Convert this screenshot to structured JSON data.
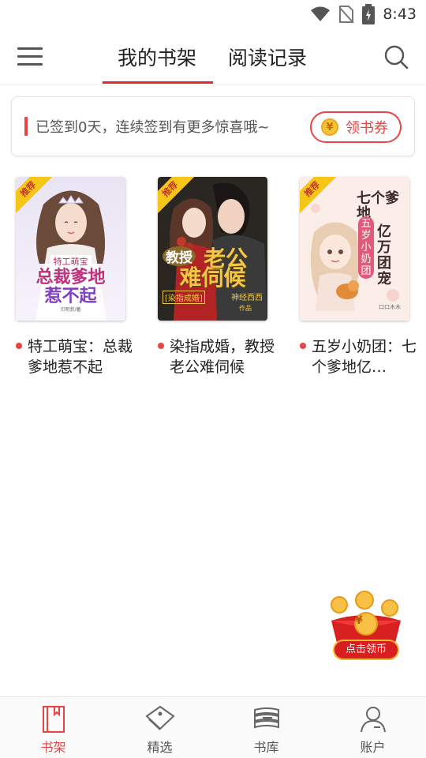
{
  "status_bar": {
    "time": "8:43",
    "icons": [
      "wifi-icon",
      "no-sim-icon",
      "battery-charging-icon"
    ]
  },
  "header": {
    "menu_icon": "hamburger-icon",
    "tabs": [
      {
        "label": "我的书架",
        "active": true
      },
      {
        "label": "阅读记录",
        "active": false
      }
    ],
    "search_icon": "search-icon",
    "accent_color": "#e02a2a"
  },
  "checkin": {
    "text": "已签到0天，连续签到有更多惊喜哦~",
    "coupon_icon_glyph": "¥",
    "coupon_label": "领书券"
  },
  "books": [
    {
      "title": "特工萌宝：总裁爹地惹不起",
      "badge": "推荐",
      "cover_text": {
        "line1": "特工萌宝",
        "line2": "总裁爹地",
        "line3": "惹不起",
        "author": "贝明菲/著"
      }
    },
    {
      "title": "染指成婚，教授老公难伺候",
      "badge": "推荐",
      "cover_text": {
        "line1": "教授",
        "line2": "老公",
        "line3": "难伺候",
        "tag": "[染指成婚]",
        "author": "神经西西",
        "suffix": "作品"
      }
    },
    {
      "title": "五岁小奶团：七个爹地亿…",
      "badge": "推荐",
      "cover_text": {
        "line1": "五岁小奶团",
        "line2": "七个爹地",
        "line3": "亿万团宠",
        "author": "口口木木"
      }
    }
  ],
  "reward": {
    "label": "点击领币",
    "glyph": "¥"
  },
  "bottom_nav": [
    {
      "label": "书架",
      "icon": "bookshelf-icon",
      "active": true
    },
    {
      "label": "精选",
      "icon": "tag-icon",
      "active": false
    },
    {
      "label": "书库",
      "icon": "library-icon",
      "active": false
    },
    {
      "label": "账户",
      "icon": "account-icon",
      "active": false
    }
  ],
  "colors": {
    "accent": "#e84545",
    "coin": "#f6c33a",
    "ribbon": "#f5c518"
  }
}
